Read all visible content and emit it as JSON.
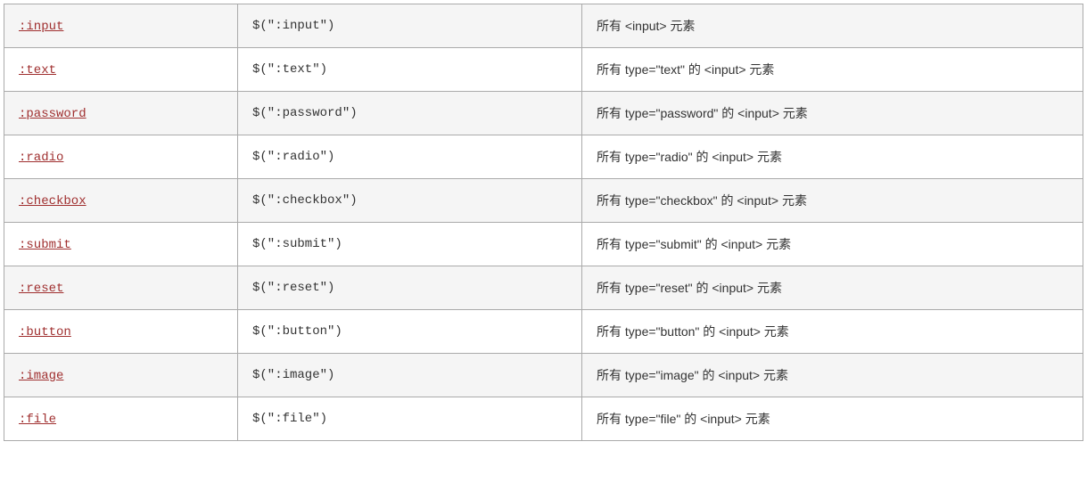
{
  "table": {
    "rows": [
      {
        "selector": ":input",
        "example": "$(\":input\")",
        "desc": "所有 <input> 元素"
      },
      {
        "selector": ":text",
        "example": "$(\":text\")",
        "desc": "所有 type=\"text\" 的 <input> 元素"
      },
      {
        "selector": ":password",
        "example": "$(\":password\")",
        "desc": "所有 type=\"password\" 的 <input> 元素"
      },
      {
        "selector": ":radio",
        "example": "$(\":radio\")",
        "desc": "所有 type=\"radio\" 的 <input> 元素"
      },
      {
        "selector": ":checkbox",
        "example": "$(\":checkbox\")",
        "desc": "所有 type=\"checkbox\" 的 <input> 元素"
      },
      {
        "selector": ":submit",
        "example": "$(\":submit\")",
        "desc": "所有 type=\"submit\" 的 <input> 元素"
      },
      {
        "selector": ":reset",
        "example": "$(\":reset\")",
        "desc": "所有 type=\"reset\" 的 <input> 元素"
      },
      {
        "selector": ":button",
        "example": "$(\":button\")",
        "desc": "所有 type=\"button\" 的 <input> 元素"
      },
      {
        "selector": ":image",
        "example": "$(\":image\")",
        "desc": "所有 type=\"image\" 的 <input> 元素"
      },
      {
        "selector": ":file",
        "example": "$(\":file\")",
        "desc": "所有 type=\"file\" 的 <input> 元素"
      }
    ]
  }
}
